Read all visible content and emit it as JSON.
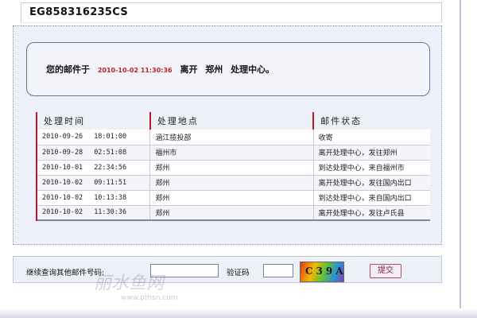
{
  "header": {
    "tracking_number": "EG858316235CS"
  },
  "status": {
    "prefix": "您的邮件于",
    "timestamp": "2010-10-02 11:30:36",
    "action": "离开",
    "city": "郑州",
    "location": "处理中心。"
  },
  "table": {
    "headers": [
      "处理时间",
      "处理地点",
      "邮件状态"
    ],
    "rows": [
      {
        "date": "2010-09-26",
        "time": "18:01:00",
        "place": "涵江揽投部",
        "state": "收寄"
      },
      {
        "date": "2010-09-28",
        "time": "02:51:08",
        "place": "福州市",
        "state": "离开处理中心，发往郑州"
      },
      {
        "date": "2010-10-01",
        "time": "22:34:56",
        "place": "郑州",
        "state": "到达处理中心，来自福州市"
      },
      {
        "date": "2010-10-02",
        "time": "09:11:51",
        "place": "郑州",
        "state": "离开处理中心，发往国内出口"
      },
      {
        "date": "2010-10-02",
        "time": "10:13:38",
        "place": "郑州",
        "state": "到达处理中心，来自国内出口"
      },
      {
        "date": "2010-10-02",
        "time": "11:30:36",
        "place": "郑州",
        "state": "离开处理中心，发往卢氏县"
      }
    ]
  },
  "query": {
    "label": "继续查询其他邮件号码:",
    "tracking_value": "",
    "captcha_label": "验证码",
    "captcha_value": "",
    "captcha_text": "C39A",
    "submit_label": "提交"
  },
  "watermark": {
    "text": "丽水鱼网",
    "url": "www.pthsn.com"
  }
}
